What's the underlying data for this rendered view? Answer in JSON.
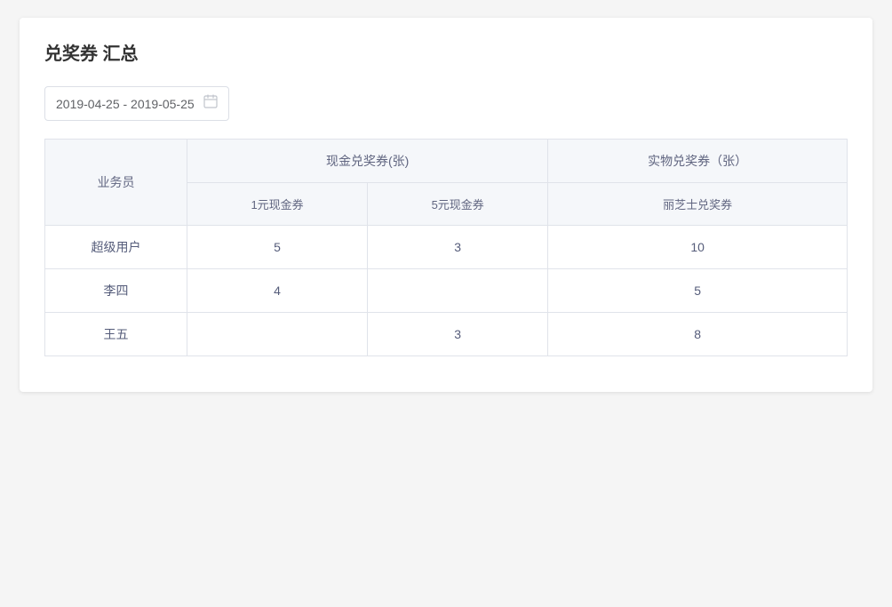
{
  "page": {
    "title": "兑奖券 汇总"
  },
  "datePicker": {
    "value": "2019-04-25 - 2019-05-25",
    "icon": "📅"
  },
  "table": {
    "col_salesperson": "业务员",
    "col_cash_group": "现金兑奖券(张)",
    "col_physical_group": "实物兑奖券（张）",
    "col_cash_1": "1元现金券",
    "col_cash_5": "5元现金券",
    "col_physical_1": "丽芝士兑奖券",
    "rows": [
      {
        "salesperson": "超级用户",
        "cash_1": "5",
        "cash_5": "3",
        "physical_1": "10"
      },
      {
        "salesperson": "李四",
        "cash_1": "4",
        "cash_5": "",
        "physical_1": "5"
      },
      {
        "salesperson": "王五",
        "cash_1": "",
        "cash_5": "3",
        "physical_1": "8"
      }
    ]
  }
}
